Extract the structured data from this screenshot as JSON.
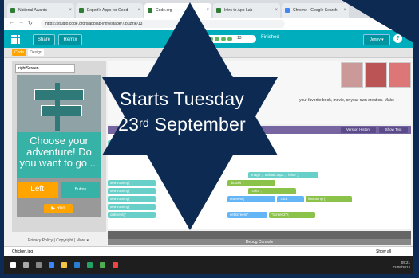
{
  "browser": {
    "tabs": [
      {
        "label": "National Awards"
      },
      {
        "label": "Expert's Apps for Good"
      },
      {
        "label": "Code.org"
      },
      {
        "label": "Intro to App Lab"
      },
      {
        "label": "Chrome - Google Search"
      }
    ],
    "address": "https://studio.code.org/s/applab-intro/stage/7/puzzle/13"
  },
  "app": {
    "share_label": "Share",
    "remix_label": "Remix",
    "level_count": "13",
    "finished_label": "Finished",
    "user_label": "Jenny ▾",
    "help_label": "?"
  },
  "toolbar": {
    "code_label": "Code",
    "design_label": "Design"
  },
  "left_panel": {
    "screen_label": "rightScreen",
    "phone_text": "Choose your adventure! Do you want to go ...",
    "left_button": "Left!",
    "bottom_button": "Button",
    "run_label": "▶ Run"
  },
  "instructions": {
    "text": "your favorite book, movie, or your own creation. Make"
  },
  "editor": {
    "version_history": "Version History",
    "show_text": "Show Text",
    "blocks": [
      "setProperty(\"",
      "image\", \"default.mp3\", \"false\");",
      "setProperty(\"",
      "setProperty(\"",
      "\"border\", \"\"",
      "\"color\",",
      "setProperty(\"",
      "setProperty(\"",
      "onEvent(\"",
      "\"click\"",
      "function() {",
      "onEvent(\"",
      "setScreen(\"",
      "\"screen2\");"
    ]
  },
  "debug_console": "Debug Console",
  "downloads": {
    "file": "Chicken.jpg",
    "show_all": "Show all"
  },
  "taskbar": {
    "time": "09:21",
    "date": "22/09/2014"
  },
  "banner": {
    "line1": "Starts Tuesday",
    "day": "23",
    "suffix": "rd",
    "month": "September"
  },
  "colors": {
    "star": "#0d2a52",
    "app_header": "#00adbc",
    "accent_orange": "#ffa400",
    "teal": "#36b2a6"
  }
}
